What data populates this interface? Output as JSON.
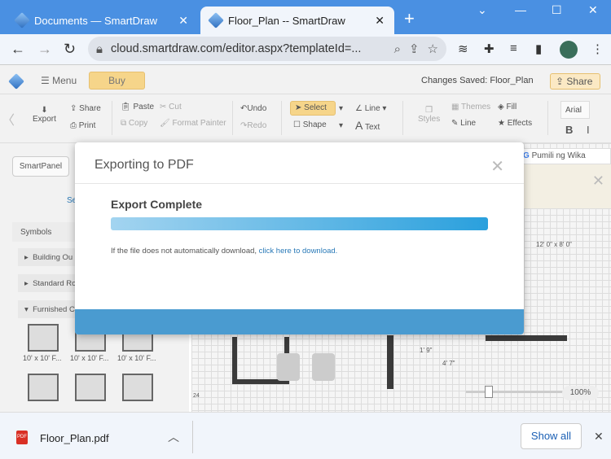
{
  "browser": {
    "tabs": [
      {
        "title": "Documents — SmartDraw",
        "active": false
      },
      {
        "title": "Floor_Plan -- SmartDraw",
        "active": true
      }
    ],
    "url": "cloud.smartdraw.com/editor.aspx?templateId=..."
  },
  "app": {
    "menu": "Menu",
    "buy": "Buy",
    "status": "Changes Saved: Floor_Plan",
    "share": "Share"
  },
  "ribbon": {
    "export": "Export",
    "share": "Share",
    "print": "Print",
    "paste": "Paste",
    "cut": "Cut",
    "copy": "Copy",
    "format_painter": "Format Painter",
    "undo": "Undo",
    "redo": "Redo",
    "select": "Select",
    "shape": "Shape",
    "line": "Line",
    "text": "Text",
    "styles": "Styles",
    "themes": "Themes",
    "fill": "Fill",
    "line2": "Line",
    "effects": "Effects",
    "font": "Arial",
    "bold": "B",
    "italic": "I"
  },
  "left": {
    "smartpanel": "SmartPanel",
    "se": "Se",
    "symbols": "Symbols",
    "groups": [
      "Building Ou",
      "Standard Ro",
      "Furnished C"
    ],
    "thumb_label": "10' x 10' F..."
  },
  "canvas": {
    "language": "Pumili ng Wika",
    "dim1": "12' 0\" x 8' 0\"",
    "dim2": "1' 9\"",
    "dim3": "4' 7\"",
    "ruler": "24",
    "zoom": "100%"
  },
  "modal": {
    "title": "Exporting to PDF",
    "status": "Export Complete",
    "progress": 100,
    "message": "If the file does not automatically download, ",
    "link": "click here to download."
  },
  "download": {
    "file": "Floor_Plan.pdf",
    "show_all": "Show all"
  }
}
